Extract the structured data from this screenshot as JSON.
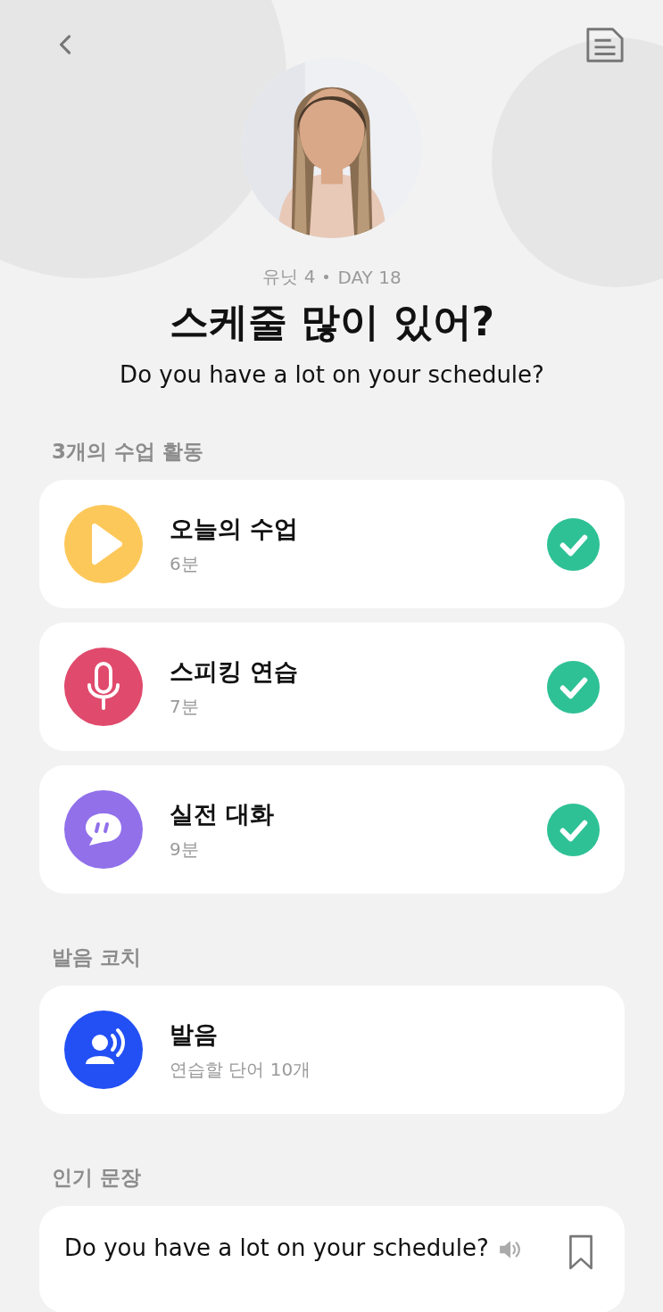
{
  "header": {
    "meta_unit": "유닛 4",
    "meta_day": "DAY 18",
    "title": "스케줄 많이 있어?",
    "subtitle": "Do you have a lot on your schedule?"
  },
  "sections": [
    {
      "label": "3개의 수업 활동",
      "items": [
        {
          "kind": "play",
          "title": "오늘의 수업",
          "detail": "6분",
          "completed": true
        },
        {
          "kind": "mic",
          "title": "스피킹 연습",
          "detail": "7분",
          "completed": true
        },
        {
          "kind": "chat",
          "title": "실전 대화",
          "detail": "9분",
          "completed": true
        }
      ]
    },
    {
      "label": "발음 코치",
      "items": [
        {
          "kind": "speech",
          "title": "발음",
          "detail": "연습할 단어 10개"
        }
      ]
    },
    {
      "label": "인기 문장",
      "sentences": [
        {
          "text": "Do you have a lot on your schedule?",
          "bookmarked": false
        }
      ]
    }
  ]
}
